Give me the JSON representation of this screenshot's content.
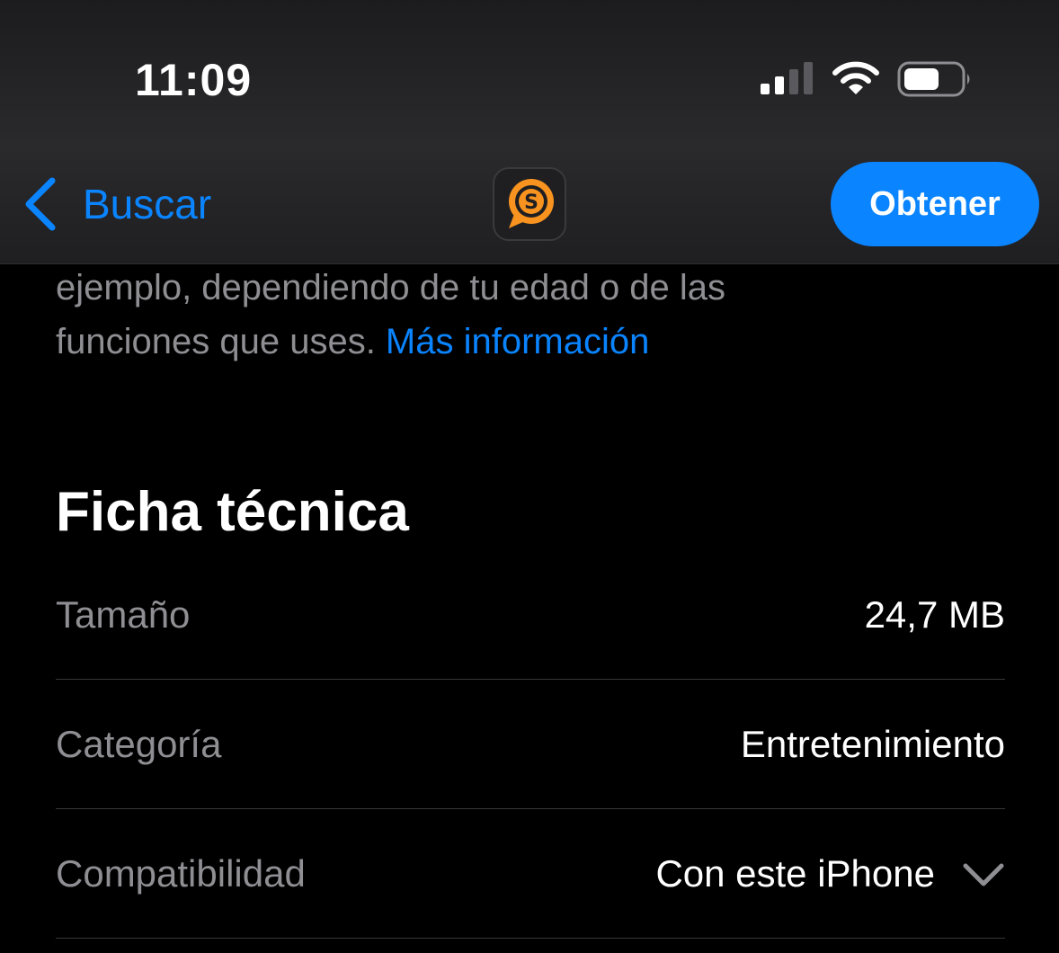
{
  "status_bar": {
    "time": "11:09"
  },
  "nav": {
    "back_label": "Buscar",
    "get_label": "Obtener",
    "app_icon": "chat-bubble-dollar-icon"
  },
  "description": {
    "line1": "ejemplo, dependiendo de tu edad o de las",
    "line2_text": "funciones que uses. ",
    "link": "Más información"
  },
  "section": {
    "title": "Ficha técnica",
    "rows": [
      {
        "key": "Tamaño",
        "value": "24,7 MB"
      },
      {
        "key": "Categoría",
        "value": "Entretenimiento"
      },
      {
        "key": "Compatibilidad",
        "value": "Con este iPhone"
      }
    ]
  },
  "colors": {
    "accent": "#0a84ff",
    "app_orange": "#f7931e",
    "secondary_text": "#8e8e93",
    "background": "#000000"
  }
}
